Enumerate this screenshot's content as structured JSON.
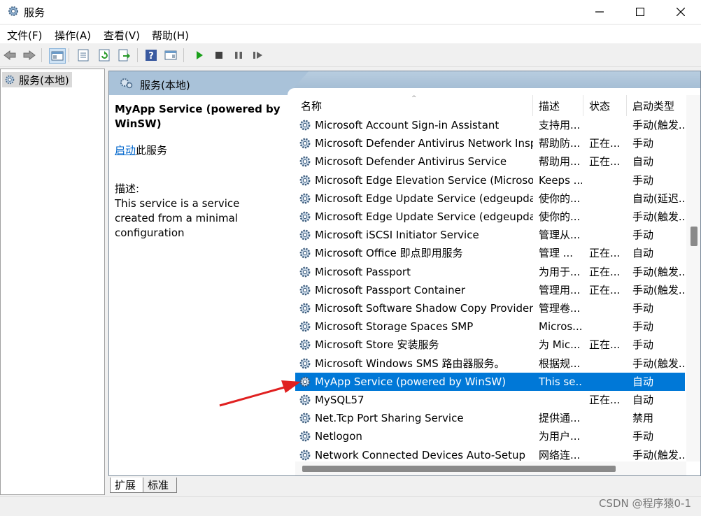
{
  "window": {
    "title": "服务"
  },
  "menu": [
    "文件(F)",
    "操作(A)",
    "查看(V)",
    "帮助(H)"
  ],
  "tree": {
    "root": "服务(本地)"
  },
  "pane": {
    "header": "服务(本地)",
    "selected_name": "MyApp Service (powered by WinSW)",
    "start_link": "启动",
    "start_suffix": "此服务",
    "desc_label": "描述:",
    "desc_text": "This service is a service created from a minimal configuration"
  },
  "columns": {
    "name": "名称",
    "desc": "描述",
    "status": "状态",
    "startup": "启动类型"
  },
  "rows": [
    {
      "name": "Microsoft Account Sign-in Assistant",
      "desc": "支持用...",
      "status": "",
      "startup": "手动(触发..."
    },
    {
      "name": "Microsoft Defender Antivirus Network Inspe...",
      "desc": "帮助防...",
      "status": "正在...",
      "startup": "手动"
    },
    {
      "name": "Microsoft Defender Antivirus Service",
      "desc": "帮助用...",
      "status": "正在...",
      "startup": "自动"
    },
    {
      "name": "Microsoft Edge Elevation Service (Microsoft...",
      "desc": "Keeps ...",
      "status": "",
      "startup": "手动"
    },
    {
      "name": "Microsoft Edge Update Service (edgeupdate)",
      "desc": "使你的...",
      "status": "",
      "startup": "自动(延迟..."
    },
    {
      "name": "Microsoft Edge Update Service (edgeupdat...",
      "desc": "使你的...",
      "status": "",
      "startup": "手动(触发..."
    },
    {
      "name": "Microsoft iSCSI Initiator Service",
      "desc": "管理从...",
      "status": "",
      "startup": "手动"
    },
    {
      "name": "Microsoft Office 即点即用服务",
      "desc": "管理 ...",
      "status": "正在...",
      "startup": "自动"
    },
    {
      "name": "Microsoft Passport",
      "desc": "为用于...",
      "status": "正在...",
      "startup": "手动(触发..."
    },
    {
      "name": "Microsoft Passport Container",
      "desc": "管理用...",
      "status": "正在...",
      "startup": "手动(触发..."
    },
    {
      "name": "Microsoft Software Shadow Copy Provider",
      "desc": "管理卷...",
      "status": "",
      "startup": "手动"
    },
    {
      "name": "Microsoft Storage Spaces SMP",
      "desc": "Micros...",
      "status": "",
      "startup": "手动"
    },
    {
      "name": "Microsoft Store 安装服务",
      "desc": "为 Mic...",
      "status": "正在...",
      "startup": "手动"
    },
    {
      "name": "Microsoft Windows SMS 路由器服务。",
      "desc": "根据规...",
      "status": "",
      "startup": "手动(触发..."
    },
    {
      "name": "MyApp Service (powered by WinSW)",
      "desc": "This se...",
      "status": "",
      "startup": "自动",
      "selected": true
    },
    {
      "name": "MySQL57",
      "desc": "",
      "status": "正在...",
      "startup": "自动"
    },
    {
      "name": "Net.Tcp Port Sharing Service",
      "desc": "提供通...",
      "status": "",
      "startup": "禁用"
    },
    {
      "name": "Netlogon",
      "desc": "为用户...",
      "status": "",
      "startup": "手动"
    },
    {
      "name": "Network Connected Devices Auto-Setup",
      "desc": "网络连...",
      "status": "",
      "startup": "手动(触发..."
    }
  ],
  "scroll": {
    "vertical_fraction": 0.38,
    "horizontal_fraction": 0.0
  },
  "tabs": [
    "扩展",
    "标准"
  ],
  "watermark": "CSDN @程序猿0-1",
  "colors": {
    "selection": "#0078d7",
    "header": "#a9c2d9",
    "arrow": "#e02020"
  }
}
